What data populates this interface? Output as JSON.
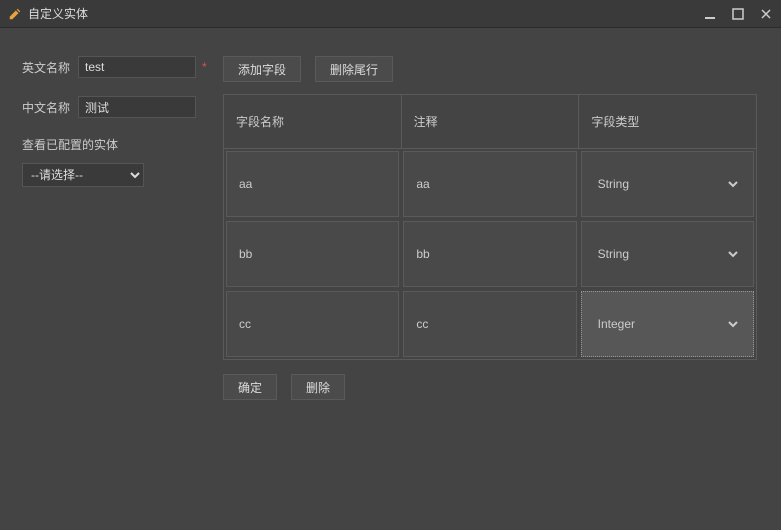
{
  "window": {
    "title": "自定义实体",
    "icon": "pencil-icon"
  },
  "form": {
    "en_name_label": "英文名称",
    "en_name_value": "test",
    "cn_name_label": "中文名称",
    "cn_name_value": "测试",
    "entity_list_label": "查看已配置的实体",
    "select_placeholder": "--请选择--"
  },
  "buttons": {
    "add_field": "添加字段",
    "delete_tail": "删除尾行",
    "confirm": "确定",
    "delete": "删除"
  },
  "table": {
    "headers": {
      "field_name": "字段名称",
      "comment": "注释",
      "field_type": "字段类型"
    },
    "rows": [
      {
        "name": "aa",
        "comment": "aa",
        "type": "String",
        "selected": false
      },
      {
        "name": "bb",
        "comment": "bb",
        "type": "String",
        "selected": false
      },
      {
        "name": "cc",
        "comment": "cc",
        "type": "Integer",
        "selected": true
      }
    ],
    "type_options": [
      "String",
      "Integer"
    ]
  }
}
